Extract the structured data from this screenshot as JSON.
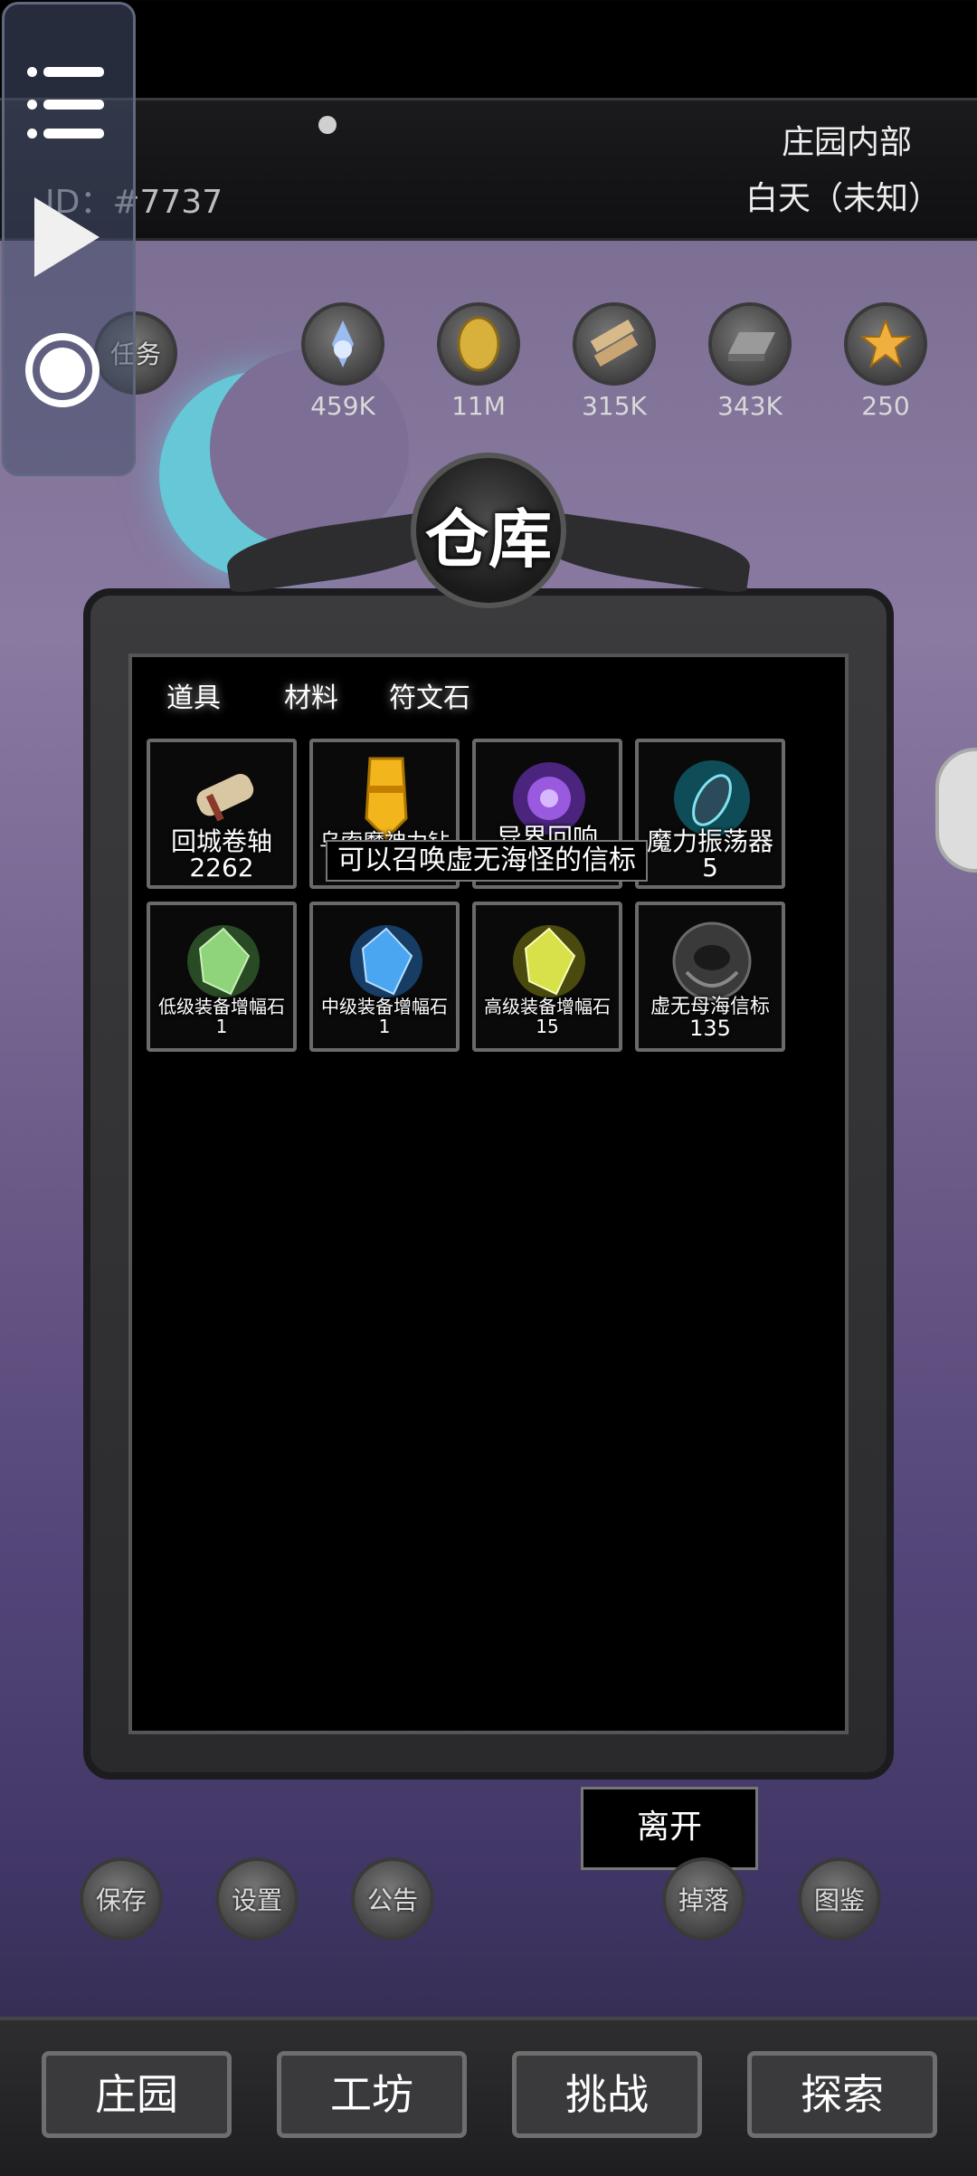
{
  "header": {
    "location": "庄园内部",
    "time": "白天（未知）",
    "player_id": "ID：#7737"
  },
  "task_button": {
    "label": "任务",
    "icon": "scroll-icon"
  },
  "resources": [
    {
      "icon": "mana-crystal-icon",
      "value": "459K"
    },
    {
      "icon": "gold-coin-icon",
      "value": "11M"
    },
    {
      "icon": "wood-planks-icon",
      "value": "315K"
    },
    {
      "icon": "iron-ingot-icon",
      "value": "343K"
    },
    {
      "icon": "star-icon",
      "value": "250"
    }
  ],
  "warehouse": {
    "title": "仓库",
    "tabs": [
      "道具",
      "材料",
      "符文石"
    ],
    "items": [
      {
        "name": "回城卷轴",
        "qty": "2262",
        "icon": "scroll-icon"
      },
      {
        "name": "乌索魔神力钻",
        "qty": "",
        "icon": "gold-crystal-icon"
      },
      {
        "name": "异界回响",
        "qty": "",
        "icon": "purple-orb-icon"
      },
      {
        "name": "魔力振荡器",
        "qty": "5",
        "icon": "oscillator-icon"
      },
      {
        "name": "低级装备增幅石",
        "qty": "1",
        "icon": "green-stone-icon"
      },
      {
        "name": "中级装备增幅石",
        "qty": "1",
        "icon": "blue-stone-icon"
      },
      {
        "name": "高级装备增幅石",
        "qty": "15",
        "icon": "yellow-stone-icon"
      },
      {
        "name": "虚无母海信标",
        "qty": "135",
        "icon": "beacon-icon"
      }
    ],
    "tooltip": "可以召唤虚无海怪的信标",
    "leave_label": "离开"
  },
  "action_buttons": [
    {
      "label": "保存"
    },
    {
      "label": "设置"
    },
    {
      "label": "公告"
    },
    {
      "label": "掉落"
    },
    {
      "label": "图鉴"
    }
  ],
  "bottom_nav": [
    "庄园",
    "工坊",
    "挑战",
    "探索"
  ]
}
